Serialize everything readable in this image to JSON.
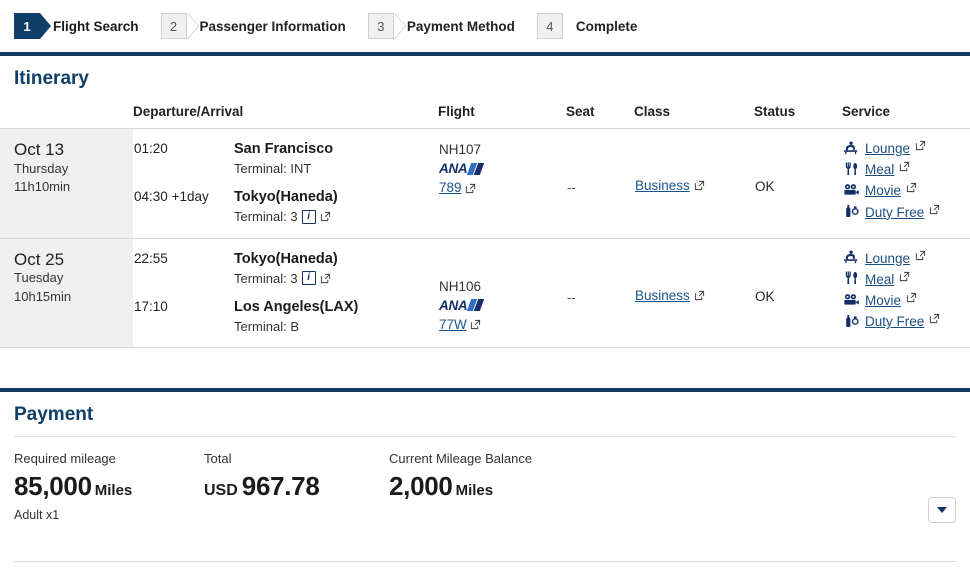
{
  "steps": [
    {
      "num": "1",
      "label": "Flight Search",
      "state": "active"
    },
    {
      "num": "2",
      "label": "Passenger Information",
      "state": "inactive"
    },
    {
      "num": "3",
      "label": "Payment Method",
      "state": "inactive"
    },
    {
      "num": "4",
      "label": "Complete",
      "state": "inactive-plain"
    }
  ],
  "itinerary": {
    "title": "Itinerary",
    "headers": {
      "date": "",
      "departure_arrival": "Departure/Arrival",
      "flight": "Flight",
      "seat": "Seat",
      "class": "Class",
      "status": "Status",
      "service": "Service"
    },
    "rows": [
      {
        "date": "Oct 13",
        "weekday": "Thursday",
        "duration": "11h10min",
        "depart": {
          "time": "01:20",
          "day_offset": "",
          "city": "San Francisco",
          "terminal": "Terminal: INT",
          "has_info": false,
          "has_ext": false
        },
        "arrive": {
          "time": "04:30",
          "day_offset": "+1day",
          "city": "Tokyo(Haneda)",
          "terminal": "Terminal: 3",
          "has_info": true,
          "has_ext": true
        },
        "flight_no": "NH107",
        "airline": "ANA",
        "equipment": "789",
        "seat": "--",
        "cabin": "Business",
        "status": "OK",
        "services": [
          "Lounge",
          "Meal",
          "Movie",
          "Duty Free"
        ]
      },
      {
        "date": "Oct 25",
        "weekday": "Tuesday",
        "duration": "10h15min",
        "depart": {
          "time": "22:55",
          "day_offset": "",
          "city": "Tokyo(Haneda)",
          "terminal": "Terminal: 3",
          "has_info": true,
          "has_ext": true
        },
        "arrive": {
          "time": "17:10",
          "day_offset": "",
          "city": "Los Angeles(LAX)",
          "terminal": "Terminal: B",
          "has_info": false,
          "has_ext": false
        },
        "flight_no": "NH106",
        "airline": "ANA",
        "equipment": "77W",
        "seat": "--",
        "cabin": "Business",
        "status": "OK",
        "services": [
          "Lounge",
          "Meal",
          "Movie",
          "Duty Free"
        ]
      }
    ]
  },
  "payment": {
    "title": "Payment",
    "required_mileage_label": "Required mileage",
    "required_mileage_value": "85,000",
    "required_mileage_unit": "Miles",
    "passenger_note": "Adult x1",
    "total_label": "Total",
    "total_currency": "USD",
    "total_value": "967.78",
    "balance_label": "Current Mileage Balance",
    "balance_value": "2,000",
    "balance_unit": "Miles",
    "toggle_icon": "chevron-down-icon"
  },
  "icons": {
    "lounge": "lounge-chair-icon",
    "meal": "fork-knife-icon",
    "movie": "movie-camera-icon",
    "duty_free": "bottle-watch-icon",
    "info": "info-icon",
    "external": "external-link-icon"
  },
  "colors": {
    "navy": "#123a5e",
    "link": "#18548f",
    "ana_blue": "#2f6fc4",
    "ana_navy": "#14306b",
    "row_bg": "#f0f0f0"
  }
}
